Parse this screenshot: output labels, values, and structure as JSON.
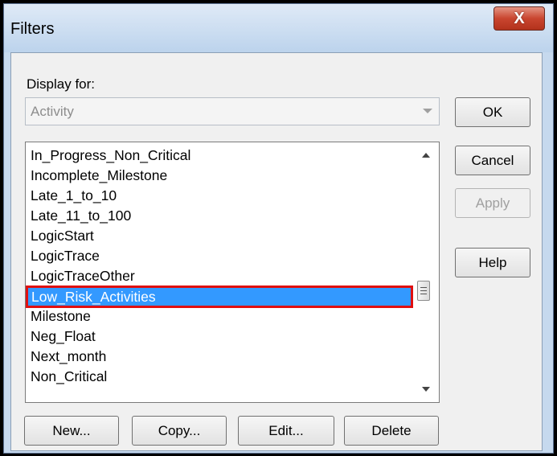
{
  "window": {
    "title": "Filters",
    "close_glyph": "X"
  },
  "display_for": {
    "label": "Display for:",
    "value": "Activity"
  },
  "list": {
    "items": [
      "In_Progress_Non_Critical",
      "Incomplete_Milestone",
      "Late_1_to_10",
      "Late_11_to_100",
      "LogicStart",
      "LogicTrace",
      "LogicTraceOther",
      "Low_Risk_Activities",
      "Milestone",
      "Neg_Float",
      "Next_month",
      "Non_Critical"
    ],
    "selected": "Low_Risk_Activities"
  },
  "side_buttons": {
    "ok": "OK",
    "cancel": "Cancel",
    "apply": "Apply",
    "help": "Help"
  },
  "bottom_buttons": {
    "new": "New...",
    "copy": "Copy...",
    "edit": "Edit...",
    "delete": "Delete"
  },
  "colors": {
    "selection": "#3399ff",
    "highlight_border": "#e01010"
  }
}
